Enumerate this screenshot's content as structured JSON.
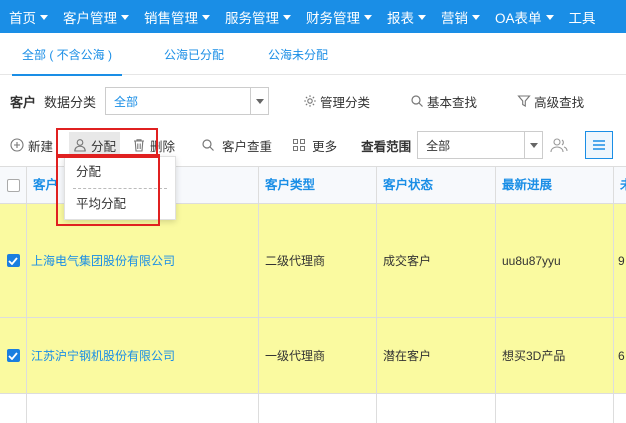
{
  "nav": {
    "items": [
      {
        "label": "首页",
        "has_caret": true
      },
      {
        "label": "客户管理",
        "has_caret": true
      },
      {
        "label": "销售管理",
        "has_caret": true
      },
      {
        "label": "服务管理",
        "has_caret": true
      },
      {
        "label": "财务管理",
        "has_caret": true
      },
      {
        "label": "报表",
        "has_caret": true
      },
      {
        "label": "营销",
        "has_caret": true
      },
      {
        "label": "OA表单",
        "has_caret": true
      },
      {
        "label": "工具",
        "has_caret": false
      }
    ]
  },
  "tabs": [
    {
      "label": "全部 ( 不含公海 )",
      "active": true
    },
    {
      "label": "公海已分配",
      "active": false
    },
    {
      "label": "公海未分配",
      "active": false
    }
  ],
  "filter": {
    "entity_label": "客户",
    "category_label": "数据分类",
    "category_value": "全部",
    "manage_category": "管理分类",
    "basic_search": "基本查找",
    "advanced_search": "高级查找"
  },
  "actions": {
    "new": "新建",
    "assign": "分配",
    "delete": "删除",
    "dedupe": "客户查重",
    "more": "更多",
    "scope_label": "查看范围",
    "scope_value": "全部"
  },
  "assign_menu": {
    "items": [
      "分配",
      "平均分配"
    ]
  },
  "table": {
    "columns": [
      "客户",
      "客户类型",
      "客户状态",
      "最新进展",
      "未"
    ],
    "rows": [
      {
        "checked": true,
        "name": "上海电气集团股份有限公司",
        "type": "二级代理商",
        "status": "成交客户",
        "progress": "uu8u87yyu",
        "extra": "9"
      },
      {
        "checked": true,
        "name": "江苏沪宁钢机股份有限公司",
        "type": "一级代理商",
        "status": "潜在客户",
        "progress": "想买3D产品",
        "extra": "6"
      }
    ]
  },
  "colors": {
    "brand": "#1a8ee6",
    "row_highlight": "#fafaa0",
    "annotation": "#e02020"
  }
}
